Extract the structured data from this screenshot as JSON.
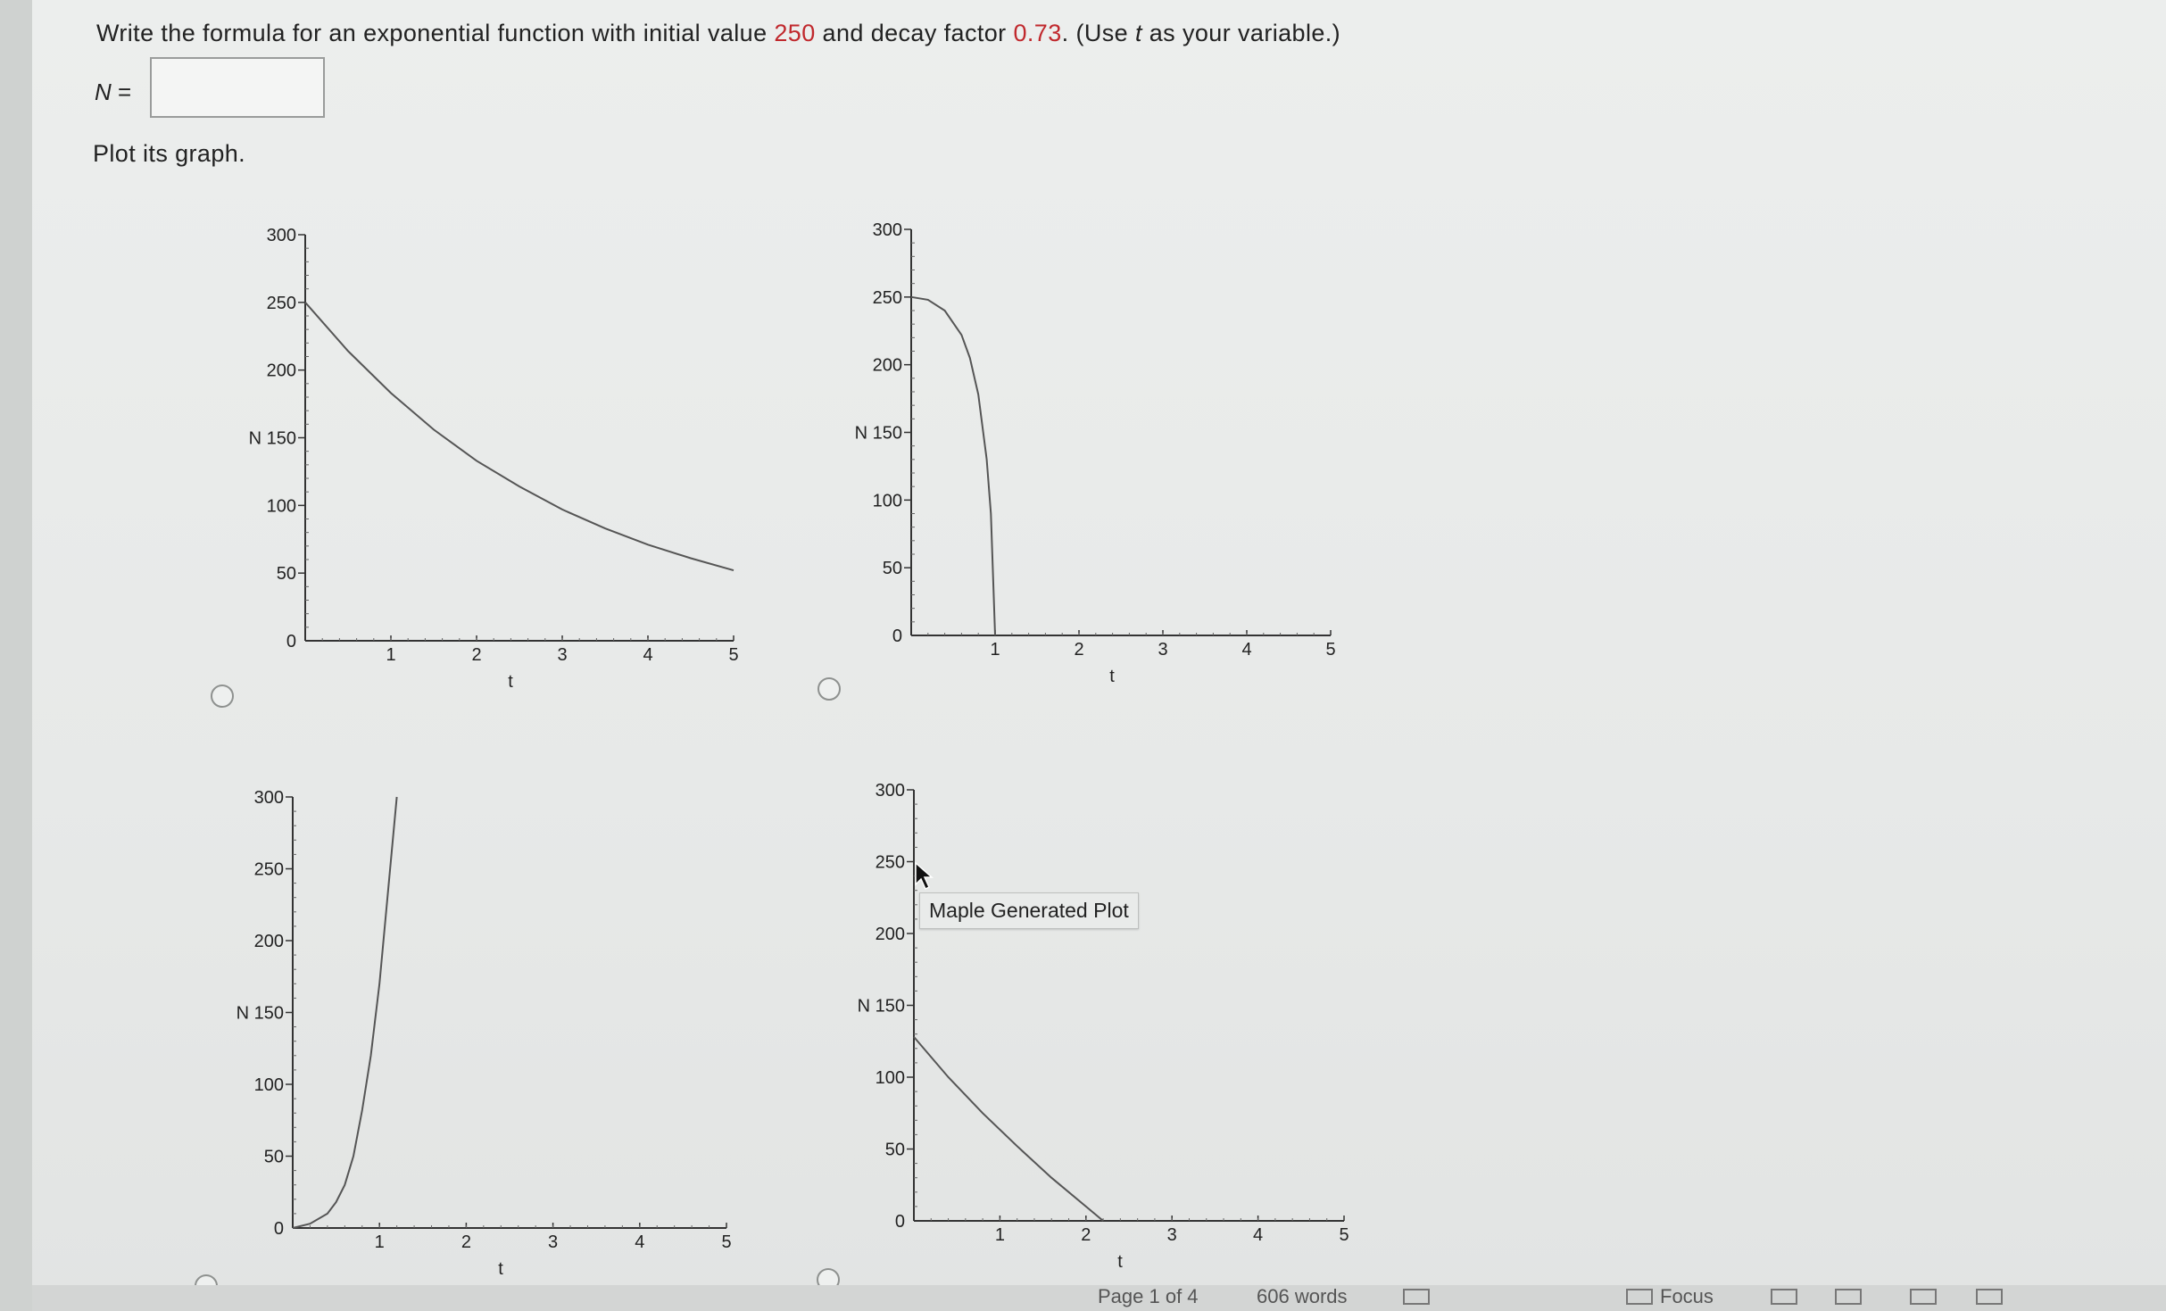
{
  "question": {
    "part1": "Write the formula for an exponential function with initial value ",
    "initial_value": "250",
    "part2": " and decay factor ",
    "decay_factor": "0.73",
    "part3": ". (Use ",
    "variable": "t",
    "part4": " as your variable.)",
    "highlight_color": "#c0282d"
  },
  "answer": {
    "label_var": "N",
    "label_eq": " =",
    "value": "",
    "placeholder": ""
  },
  "plot_prompt": "Plot its graph.",
  "options": [
    {
      "id": "A",
      "selected": false
    },
    {
      "id": "B",
      "selected": false
    },
    {
      "id": "C",
      "selected": false
    },
    {
      "id": "D",
      "selected": false
    }
  ],
  "tooltip": "Maple Generated Plot",
  "status_bar": {
    "page": "Page 1 of 4",
    "words": "606 words",
    "focus": "Focus"
  },
  "chart_data": [
    {
      "type": "line",
      "xlabel": "t",
      "ylabel": "N",
      "xlim": [
        0,
        5
      ],
      "ylim": [
        0,
        300
      ],
      "x_ticks": [
        "1",
        "2",
        "3",
        "4",
        "5"
      ],
      "y_ticks": [
        "300",
        "250",
        "200",
        "N 150",
        "100",
        "50",
        "0"
      ],
      "series": [
        {
          "x": [
            0,
            0.5,
            1,
            1.5,
            2,
            2.5,
            3,
            3.5,
            4,
            4.5,
            5
          ],
          "y": [
            250,
            214,
            183,
            156,
            133,
            114,
            97,
            83,
            71,
            61,
            52
          ]
        }
      ]
    },
    {
      "type": "line",
      "xlabel": "t",
      "ylabel": "N",
      "xlim": [
        0,
        5
      ],
      "ylim": [
        0,
        300
      ],
      "x_ticks": [
        "1",
        "2",
        "3",
        "4",
        "5"
      ],
      "y_ticks": [
        "300",
        "250",
        "200",
        "N 150",
        "100",
        "50",
        "0"
      ],
      "series": [
        {
          "x": [
            0,
            0.2,
            0.4,
            0.6,
            0.7,
            0.8,
            0.9,
            0.95,
            1.0
          ],
          "y": [
            250,
            248,
            240,
            222,
            205,
            178,
            130,
            90,
            0
          ]
        }
      ]
    },
    {
      "type": "line",
      "xlabel": "t",
      "ylabel": "N",
      "xlim": [
        0,
        5
      ],
      "ylim": [
        0,
        300
      ],
      "x_ticks": [
        "1",
        "2",
        "3",
        "4",
        "5"
      ],
      "y_ticks": [
        "300",
        "250",
        "200",
        "N 150",
        "100",
        "50",
        "0"
      ],
      "series": [
        {
          "x": [
            0,
            0.2,
            0.4,
            0.5,
            0.6,
            0.7,
            0.8,
            0.9,
            1.0,
            1.1,
            1.2
          ],
          "y": [
            0,
            3,
            10,
            18,
            30,
            50,
            82,
            120,
            170,
            235,
            300
          ]
        }
      ]
    },
    {
      "type": "line",
      "xlabel": "t",
      "ylabel": "N",
      "xlim": [
        0,
        5
      ],
      "ylim": [
        0,
        300
      ],
      "x_ticks": [
        "1",
        "2",
        "3",
        "4",
        "5"
      ],
      "y_ticks": [
        "300",
        "250",
        "200",
        "N 150",
        "100",
        "50",
        "0"
      ],
      "series": [
        {
          "x": [
            0,
            0.4,
            0.8,
            1.2,
            1.6,
            2.0,
            2.2
          ],
          "y": [
            128,
            100,
            75,
            52,
            30,
            10,
            0
          ]
        }
      ]
    }
  ]
}
